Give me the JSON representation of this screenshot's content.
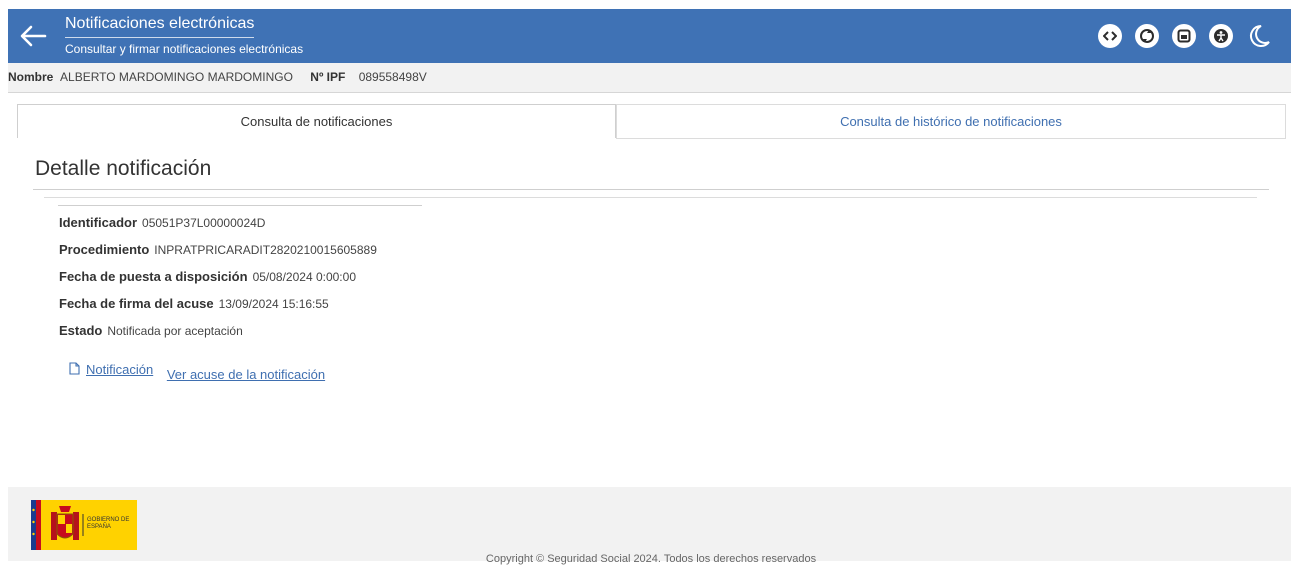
{
  "header": {
    "title": "Notificaciones electrónicas",
    "subtitle": "Consultar y firmar notificaciones electrónicas",
    "icons": [
      "code-icon",
      "refresh-icon",
      "calendar-icon",
      "accessibility-icon",
      "moon-icon"
    ]
  },
  "user": {
    "name_label": "Nombre",
    "name_value": "ALBERTO MARDOMINGO MARDOMINGO",
    "ipf_label": "Nº IPF",
    "ipf_value": "089558498V"
  },
  "tabs": [
    {
      "label": "Consulta de notificaciones",
      "active": true
    },
    {
      "label": "Consulta de histórico de notificaciones",
      "active": false
    }
  ],
  "detail": {
    "title": "Detalle notificación",
    "fields": [
      {
        "label": "Identificador",
        "value": "05051P37L00000024D"
      },
      {
        "label": "Procedimiento",
        "value": "INPRATPRICARADIT2820210015605889"
      },
      {
        "label": "Fecha de puesta a disposición",
        "value": "05/08/2024 0:00:00"
      },
      {
        "label": "Fecha de firma del acuse",
        "value": "13/09/2024 15:16:55"
      },
      {
        "label": "Estado",
        "value": "Notificada por aceptación"
      }
    ],
    "link_notification": "Notificación",
    "link_acuse": "Ver acuse de la notificación"
  },
  "footer": {
    "logo_text": "GOBIERNO DE ESPAÑA",
    "copyright": "Copyright © Seguridad Social 2024. Todos los derechos reservados"
  },
  "colors": {
    "header_bg": "#3f72b5",
    "link": "#3f6fb0",
    "footer_bg": "#f2f2f2",
    "logo_yellow": "#ffd200"
  }
}
